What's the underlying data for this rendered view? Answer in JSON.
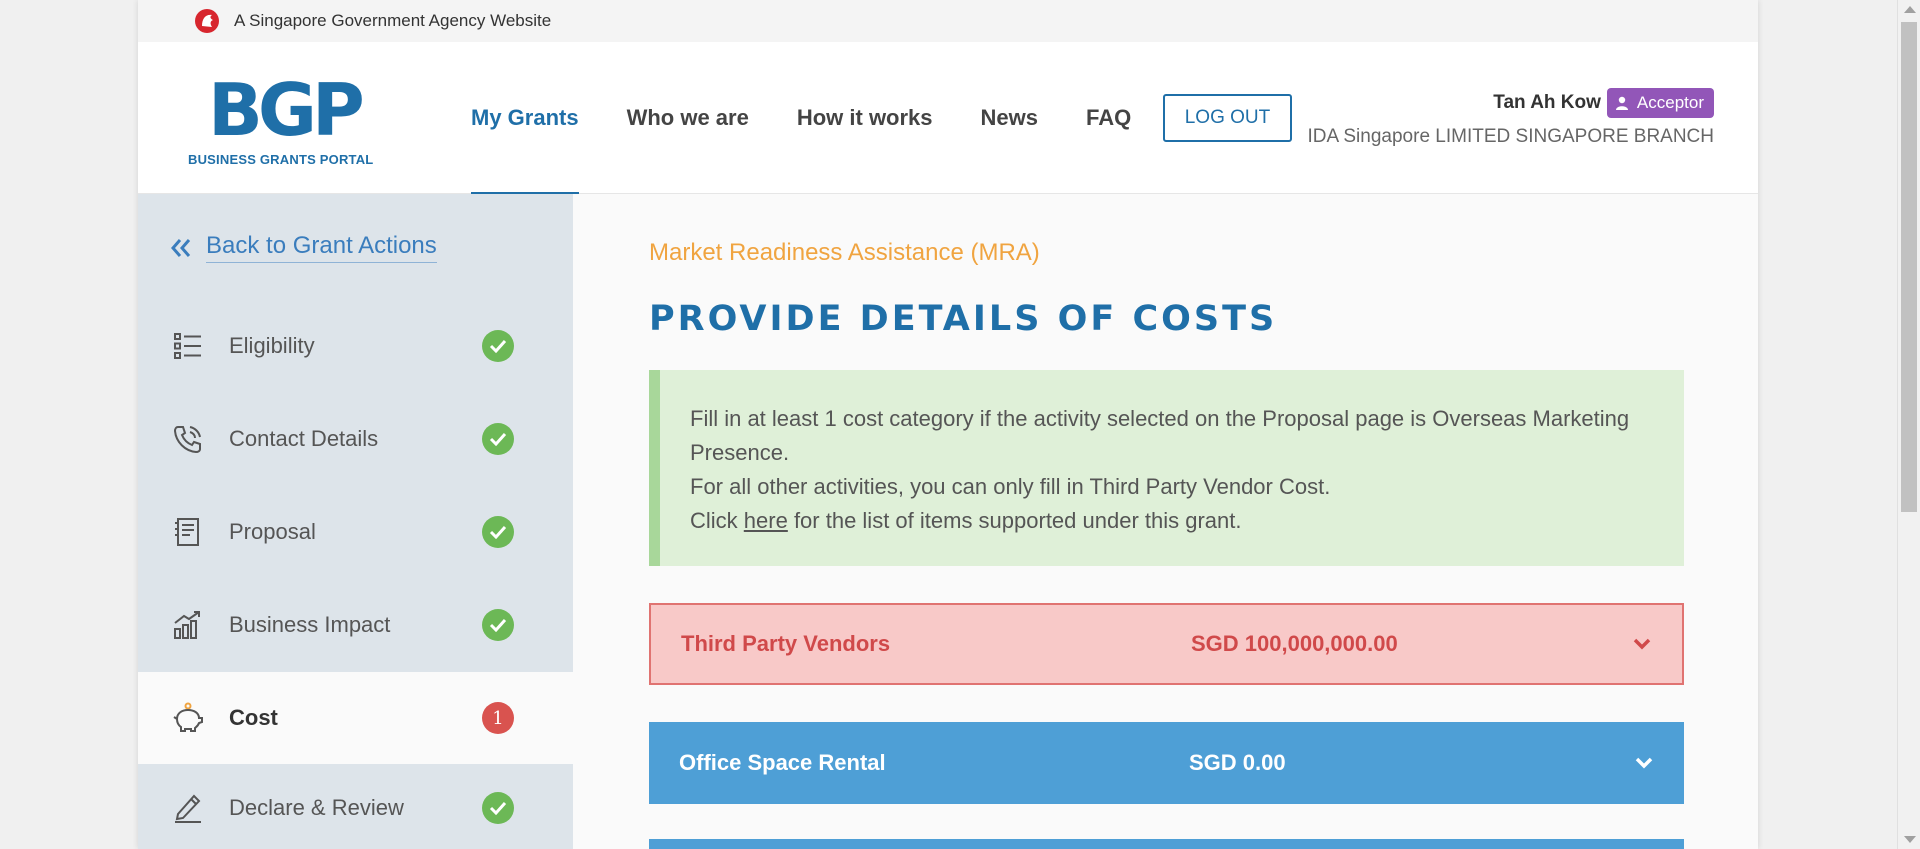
{
  "gov_banner": {
    "text": "A Singapore Government Agency Website",
    "icon": "merlion-lion-icon"
  },
  "logo": {
    "mark": "BGP",
    "subtitle": "BUSINESS GRANTS PORTAL"
  },
  "nav": {
    "items": [
      {
        "label": "My Grants",
        "active": true
      },
      {
        "label": "Who we are",
        "active": false
      },
      {
        "label": "How it works",
        "active": false
      },
      {
        "label": "News",
        "active": false
      },
      {
        "label": "FAQ",
        "active": false
      }
    ],
    "logout_label": "LOG OUT"
  },
  "user": {
    "name": "Tan Ah Kow",
    "role": "Acceptor",
    "company": "IDA Singapore LIMITED SINGAPORE BRANCH"
  },
  "sidebar": {
    "back_label": "Back to Grant Actions",
    "steps": [
      {
        "label": "Eligibility",
        "icon": "list-icon",
        "status": "complete"
      },
      {
        "label": "Contact Details",
        "icon": "phone-icon",
        "status": "complete"
      },
      {
        "label": "Proposal",
        "icon": "document-icon",
        "status": "complete"
      },
      {
        "label": "Business Impact",
        "icon": "chart-growth-icon",
        "status": "complete"
      },
      {
        "label": "Cost",
        "icon": "piggy-bank-icon",
        "status": "error",
        "error_count": "1",
        "active": true
      },
      {
        "label": "Declare & Review",
        "icon": "pen-sign-icon",
        "status": "complete"
      }
    ]
  },
  "main": {
    "grant_name": "Market Readiness Assistance (MRA)",
    "title": "PROVIDE DETAILS OF COSTS",
    "info": {
      "line1": "Fill in at least 1 cost category if the activity selected on the Proposal page is Overseas Marketing Presence.",
      "line2": "For all other activities, you can only fill in Third Party Vendor Cost.",
      "line3_prefix": "Click ",
      "line3_link": "here",
      "line3_suffix": " for the list of items supported under this grant."
    },
    "cost_categories": [
      {
        "name": "Third Party Vendors",
        "amount": "SGD 100,000,000.00",
        "state": "error"
      },
      {
        "name": "Office Space Rental",
        "amount": "SGD 0.00",
        "state": "normal"
      }
    ]
  },
  "colors": {
    "brand_blue": "#1f6fa8",
    "accent_orange": "#f0a440",
    "success_green": "#6cb856",
    "error_red": "#d9534f",
    "role_purple": "#9256b8",
    "row_blue": "#4e9fd6"
  }
}
